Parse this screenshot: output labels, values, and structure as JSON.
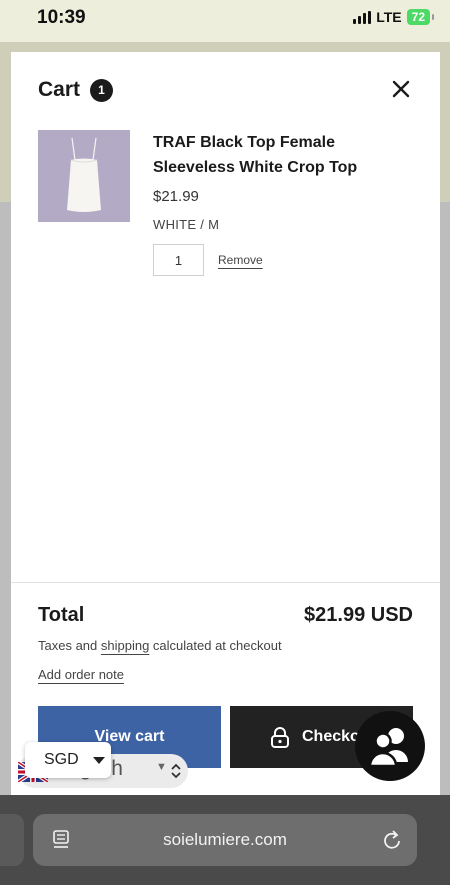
{
  "status_bar": {
    "time": "10:39",
    "network": "LTE",
    "battery": "72"
  },
  "cart": {
    "title": "Cart",
    "count": "1",
    "item": {
      "title": "TRAF Black Top Female Sleeveless White Crop Top",
      "price": "$21.99",
      "variant": "WHITE / M",
      "quantity": "1",
      "remove_label": "Remove"
    },
    "total_label": "Total",
    "total_value": "$21.99 USD",
    "tax_prefix": "Taxes and ",
    "tax_link": "shipping",
    "tax_suffix": " calculated at checkout",
    "order_note": "Add order note",
    "view_cart_label": "View cart",
    "checkout_label": "Checkout"
  },
  "language_selector": {
    "label": "English"
  },
  "currency_selector": {
    "value": "SGD"
  },
  "browser": {
    "url": "soielumiere.com"
  },
  "colors": {
    "view_cart": "#3d63a5",
    "checkout": "#222222",
    "battery": "#4cd964"
  }
}
